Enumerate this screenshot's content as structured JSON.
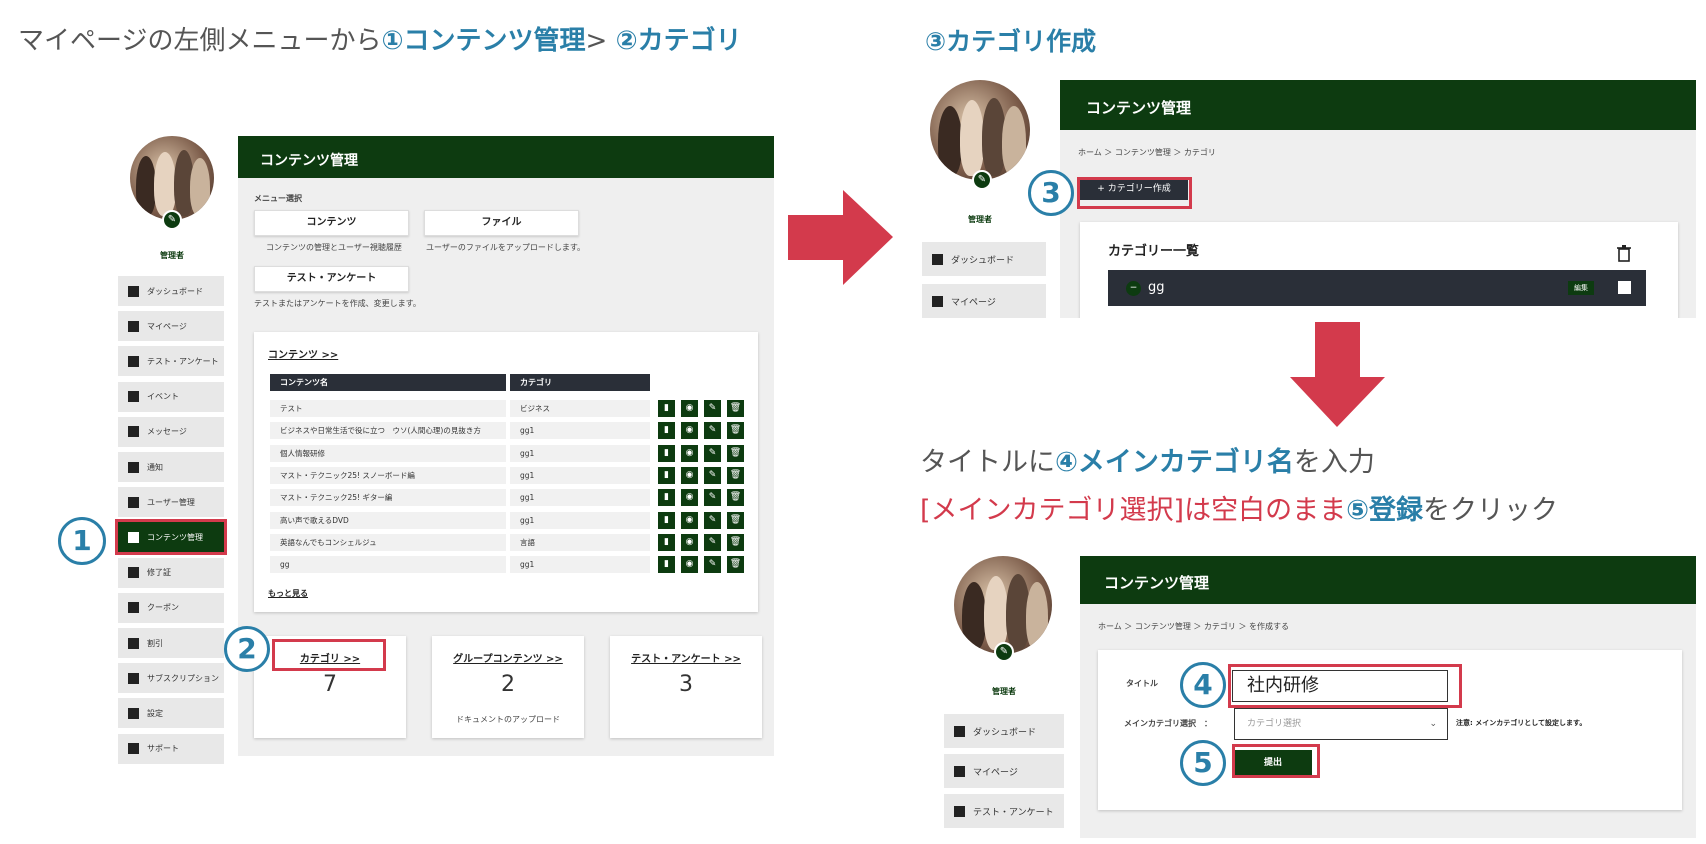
{
  "headings": {
    "step12_prefix": "マイページの左側メニューから",
    "step12_hl1": "①コンテンツ管理",
    "step12_sep": ">",
    "step12_hl2": "②カテゴリ",
    "step3": "③カテゴリ作成",
    "step45_line1_prefix": "タイトルに",
    "step45_line1_hl": "④メインカテゴリ名",
    "step45_line1_suffix": "を入力",
    "step45_line2_red": "[メインカテゴリ選択]は空白のまま",
    "step45_line2_hl": "⑤登録",
    "step45_line2_suffix": "をクリック"
  },
  "badges": {
    "n1": "1",
    "n2": "2",
    "n3": "3",
    "n4": "4",
    "n5": "5"
  },
  "panel1": {
    "header": "コンテンツ管理",
    "user_name": "管理者",
    "menu_select_label": "メニュー選択",
    "btn_contents": "コンテンツ",
    "btn_contents_desc": "コンテンツの管理とユーザー視聴履歴",
    "btn_file": "ファイル",
    "btn_file_desc": "ユーザーのファイルをアップロードします。",
    "btn_test": "テスト・アンケート",
    "btn_test_desc": "テストまたはアンケートを作成、変更します。",
    "sidebar": [
      "ダッシュボード",
      "マイページ",
      "テスト・アンケート",
      "イベント",
      "メッセージ",
      "通知",
      "ユーザー管理",
      "コンテンツ管理",
      "修了証",
      "クーポン",
      "割引",
      "サブスクリプション",
      "設定",
      "サポート"
    ],
    "contents_link": "コンテンツ >>",
    "col_name": "コンテンツ名",
    "col_category": "カテゴリ",
    "rows": [
      {
        "name": "テスト",
        "cat": "ビジネス"
      },
      {
        "name": "ビジネスや日常生活で役に立つ　ウソ(人間心理)の見抜き方",
        "cat": "gg1"
      },
      {
        "name": "個人情報研修",
        "cat": "gg1"
      },
      {
        "name": "マスト・テクニック25! スノーボード編",
        "cat": "gg1"
      },
      {
        "name": "マスト・テクニック25! ギター編",
        "cat": "gg1"
      },
      {
        "name": "高い声で歌えるDVD",
        "cat": "gg1"
      },
      {
        "name": "英語なんでもコンシェルジュ",
        "cat": "言語"
      },
      {
        "name": "gg",
        "cat": "gg1"
      }
    ],
    "more_link": "もっと見る",
    "card_category_link": "カテゴリ >>",
    "card_category_count": "7",
    "card_group_link": "グループコンテンツ >>",
    "card_group_count": "2",
    "card_group_desc": "ドキュメントのアップロード",
    "card_test_link": "テスト・アンケート >>",
    "card_test_count": "3"
  },
  "panel2": {
    "header": "コンテンツ管理",
    "user_name": "管理者",
    "breadcrumb": "ホーム ＞ コンテンツ管理 ＞ カテゴリ",
    "create_button": "+ カテゴリー作成",
    "list_title": "カテゴリー一覧",
    "item_name": "gg",
    "edit_label": "編集",
    "sidebar": [
      "ダッシュボード",
      "マイページ"
    ]
  },
  "panel3": {
    "header": "コンテンツ管理",
    "user_name": "管理者",
    "breadcrumb": "ホーム ＞ コンテンツ管理 ＞ カテゴリ ＞ を作成する",
    "title_label": "タイトル",
    "title_value": "社内研修",
    "main_cat_label": "メインカテゴリ選択　：",
    "main_cat_placeholder": "カテゴリ選択",
    "note": "注意: メインカテゴリとして設定します。",
    "submit": "提出",
    "sidebar": [
      "ダッシュボード",
      "マイページ",
      "テスト・アンケート"
    ]
  },
  "colors": {
    "brand_green": "#0d3b10",
    "accent_blue": "#2a7fa8",
    "highlight_red": "#d33a4c"
  }
}
